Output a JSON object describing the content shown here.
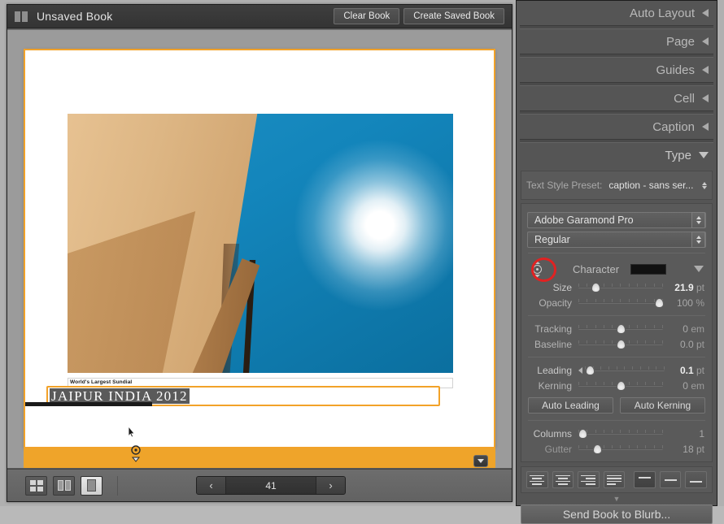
{
  "titlebar": {
    "title": "Unsaved Book",
    "clear_label": "Clear Book",
    "create_label": "Create Saved Book"
  },
  "page_preview": {
    "caption_text": "World's Largest Sundial",
    "title_text": "JAIPUR  INDIA  2012"
  },
  "bottom_bar": {
    "page_number": "41",
    "prev_glyph": "‹",
    "next_glyph": "›"
  },
  "panels": [
    {
      "label": "Auto Layout",
      "state": "collapsed"
    },
    {
      "label": "Page",
      "state": "collapsed"
    },
    {
      "label": "Guides",
      "state": "collapsed"
    },
    {
      "label": "Cell",
      "state": "collapsed"
    },
    {
      "label": "Caption",
      "state": "collapsed"
    },
    {
      "label": "Type",
      "state": "expanded"
    }
  ],
  "type_panel": {
    "preset_label": "Text Style Preset:",
    "preset_value": "caption - sans ser...",
    "font_family": "Adobe Garamond Pro",
    "font_style": "Regular",
    "character_label": "Character",
    "character_color": "#111111",
    "sliders": [
      {
        "label": "Size",
        "value": "21.9",
        "unit": "pt",
        "pos": 20,
        "bold": true
      },
      {
        "label": "Opacity",
        "value": "100",
        "unit": "%",
        "pos": 95,
        "bold": false
      },
      {
        "label": "Tracking",
        "value": "0",
        "unit": "em",
        "pos": 50,
        "bold": false
      },
      {
        "label": "Baseline",
        "value": "0.0",
        "unit": "pt",
        "pos": 50,
        "bold": false
      },
      {
        "label": "Leading",
        "value": "0.1",
        "unit": "pt",
        "pos": 6,
        "bold": true
      },
      {
        "label": "Kerning",
        "value": "0",
        "unit": "em",
        "pos": 50,
        "bold": false
      },
      {
        "label": "Columns",
        "value": "1",
        "unit": "",
        "pos": 5,
        "bold": false
      },
      {
        "label": "Gutter",
        "value": "18",
        "unit": "pt",
        "pos": 22,
        "bold": false
      }
    ],
    "auto_leading_label": "Auto Leading",
    "auto_kerning_label": "Auto Kerning"
  },
  "footer": {
    "send_label": "Send Book to Blurb..."
  },
  "icons": {
    "grid_view": "grid-view-icon",
    "spread_view": "spread-view-icon",
    "single_view": "single-page-view-icon",
    "target_adjust": "targeted-adjustment-icon",
    "band_chevron": "chevron-down-icon"
  },
  "colors": {
    "selection_orange": "#f2a229",
    "annotation_red": "#e02222",
    "band_orange": "#efa42a"
  }
}
